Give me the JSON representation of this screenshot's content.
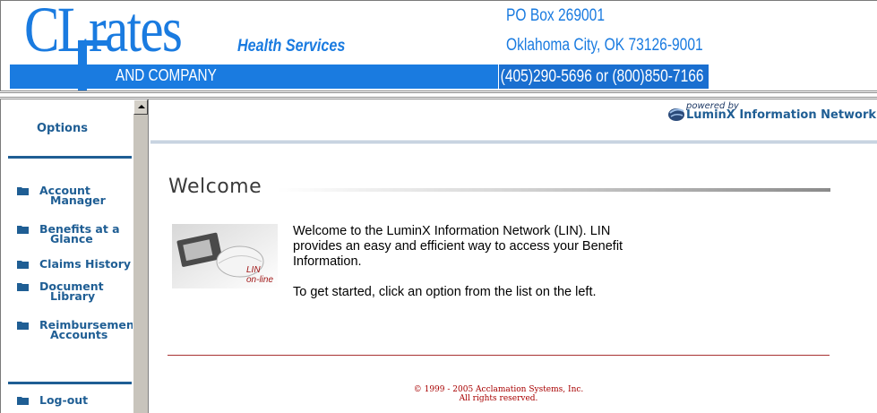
{
  "header": {
    "logo_cl": "CL",
    "logo_frates": "rates",
    "logo_health": "Health Services",
    "logo_company": "AND COMPANY",
    "address_line1": "PO Box 269001",
    "address_line2": "Oklahoma City, OK 73126-9001",
    "phone": "(405)290-5696 or (800)850-7166"
  },
  "sidebar": {
    "title": "Options",
    "items": [
      {
        "line1": "Account",
        "line2": "Manager"
      },
      {
        "line1": "Benefits at a",
        "line2": "Glance"
      },
      {
        "line1": "Claims History",
        "line2": ""
      },
      {
        "line1": "Document",
        "line2": "Library"
      },
      {
        "line1": "Reimbursemen",
        "line2": "Accounts"
      }
    ],
    "logout": "Log-out",
    "icon": "folder-icon"
  },
  "powered": {
    "powered_by": "powered by",
    "network": "LuminX Information Network"
  },
  "main": {
    "title": "Welcome",
    "image_caption_1": "LIN",
    "image_caption_2": "on-line",
    "paragraph1": "Welcome to the LuminX Information Network (LIN). LIN provides an easy and efficient way to access your Benefit Information.",
    "paragraph2": "To get started, click an option from the list on the left."
  },
  "footer": {
    "copyright_line1": "© 1999 - 2005 Acclamation Systems, Inc.",
    "copyright_line2": "All rights reserved."
  },
  "colors": {
    "brand_blue": "#1a7be0",
    "nav_blue": "#1f5e94",
    "footer_red": "#a80000"
  }
}
